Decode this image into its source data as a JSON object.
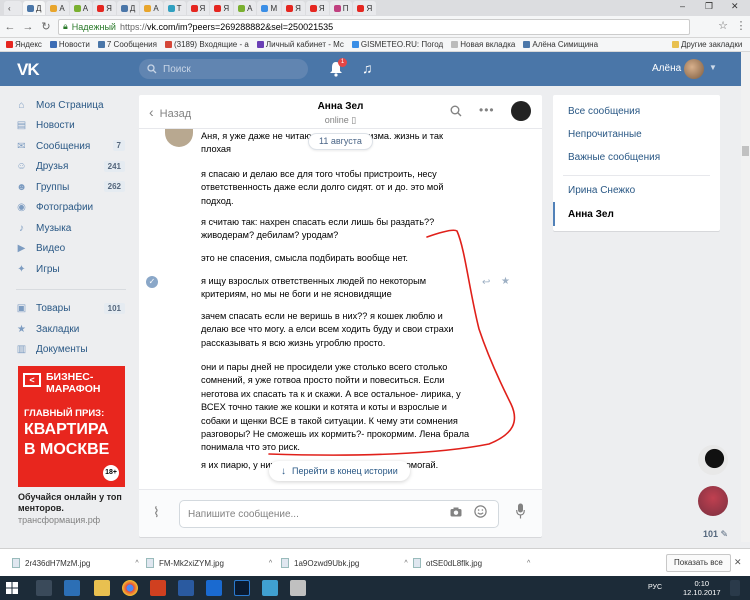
{
  "browser": {
    "tabs": [
      "Д",
      "А",
      "А",
      "Я",
      "Д",
      "А",
      "Т",
      "Я",
      "Я",
      "А",
      "М",
      "Я",
      "Я",
      "П",
      "Я"
    ],
    "window_minimize": "–",
    "window_maximize": "❐",
    "window_close": "✕",
    "address": {
      "secure_label": "Надежный",
      "url_host": "https://",
      "url_main": "vk.com/im?peers=269288882&sel=250021535"
    },
    "bookmarks": [
      {
        "label": "Яндекс",
        "color": "#e52620"
      },
      {
        "label": "Новости",
        "color": "#3d6db5"
      },
      {
        "label": "7 Сообщения",
        "color": "#4a76a8"
      },
      {
        "label": "(3189) Входящие - а",
        "color": "#d44638"
      },
      {
        "label": "Личный кабинет - Мс",
        "color": "#6a3fb5"
      },
      {
        "label": "GISMETEO.RU: Погод",
        "color": "#3a8ee6"
      },
      {
        "label": "Новая вкладка",
        "color": "#bbbbbb"
      },
      {
        "label": "Алёна Симищина",
        "color": "#4a76a8"
      }
    ],
    "bookmarks_more": "Другие закладки"
  },
  "vk": {
    "logo": "VK",
    "search_placeholder": "Поиск",
    "notifications_count": "1",
    "user_name": "Алёна"
  },
  "leftmenu": {
    "items": [
      {
        "label": "Моя Страница",
        "icon": "⌂"
      },
      {
        "label": "Новости",
        "icon": "▤"
      },
      {
        "label": "Сообщения",
        "icon": "✉",
        "count": "7"
      },
      {
        "label": "Друзья",
        "icon": "☺",
        "count": "241"
      },
      {
        "label": "Группы",
        "icon": "☻",
        "count": "262"
      },
      {
        "label": "Фотографии",
        "icon": "◉"
      },
      {
        "label": "Музыка",
        "icon": "♪"
      },
      {
        "label": "Видео",
        "icon": "▶"
      },
      {
        "label": "Игры",
        "icon": "✦"
      }
    ],
    "items2": [
      {
        "label": "Товары",
        "icon": "▣",
        "count": "101"
      },
      {
        "label": "Закладки",
        "icon": "★"
      },
      {
        "label": "Документы",
        "icon": "▥"
      }
    ]
  },
  "ad": {
    "line1": "БИЗНЕС-",
    "line2": "МАРАФОН",
    "line3": "ГЛАВНЫЙ ПРИЗ:",
    "line4": "КВАРТИРА",
    "line5": "В МОСКВЕ",
    "age": "18+",
    "caption": "Обучайся онлайн у топ менторов.",
    "site": "трансформация.рф"
  },
  "chat": {
    "back_label": "Назад",
    "name": "Анна Зел",
    "status": "online",
    "date": "11 августа",
    "paragraphs": [
      "Аня, я уже даже не читаю про их гуманизма. жизнь и так плохая",
      "я спасаю и делаю все для того чтобы пристроить, несу ответственность даже если долго сидят. от и до. это мой подход.",
      "я считаю так: нахрен спасать если лишь бы раздать?? живодерам? дебилам? уродам?",
      "это не спасения, смысла подбирать вообще нет.",
      "я ищу взрослых ответственных людей по некоторым критериям, но мы не боги и не ясновидящие",
      "зачем спасать если не веришь в них?? я кошек люблю и делаю все что могу. а елси всем ходить буду и свои страхи рассказывать я всю жизнь угроблю просто.",
      "они и пары дней не просидели уже столько всего столько сомнений, я уже готвоа просто пойти и повеситься. Если неготова их спасать та к и скажи. А все остальное- лирика, у ВСЕХ точно такие же кошки и котята и коты и взрослые и собаки и щенки ВСЕ в такой ситуации. К чему эти сомнения разговоры? Не сможешь их кормить?- прокормим. Лена брала понимала что это риск.",
      "я их пиарю, у них все хорошо. могу помогать - помогай."
    ],
    "jump_label": "Перейти в конец истории",
    "composer_placeholder": "Напишите сообщение..."
  },
  "rightpanel": {
    "all": "Все сообщения",
    "unread": "Непрочитанные",
    "important": "Важные сообщения",
    "contact1": "Ирина Снежко",
    "contact2": "Анна Зел"
  },
  "right_counter": "101",
  "downloads": {
    "files": [
      "2r436dH7MzM.jpg",
      "FM-Mk2xiZYM.jpg",
      "1a9Ozwd9Ubk.jpg",
      "otSE0dL8flk.jpg"
    ],
    "show_all": "Показать все"
  },
  "taskbar": {
    "lang": "РУС",
    "time": "0:10",
    "date": "12.10.2017"
  },
  "colors": {
    "vk_blue": "#4a76a8",
    "link": "#2a5885",
    "annotation": "#e0201a"
  }
}
